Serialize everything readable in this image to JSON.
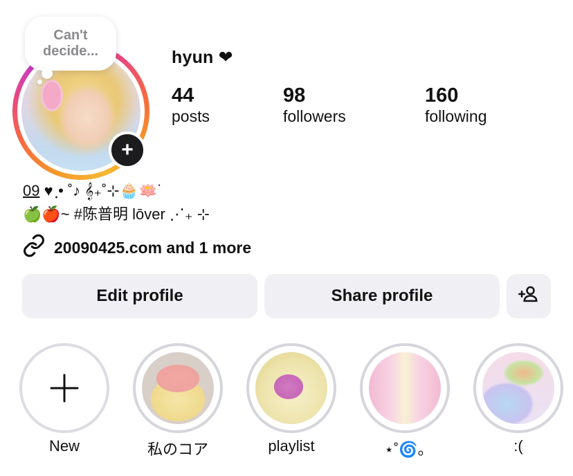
{
  "profile": {
    "note_line1": "Can't",
    "note_line2": "decide...",
    "username": "hyun ❤",
    "add_story_icon": "plus-icon"
  },
  "stats": {
    "posts": {
      "value": "44",
      "label": "posts"
    },
    "followers": {
      "value": "98",
      "label": "followers"
    },
    "following": {
      "value": "160",
      "label": "following"
    }
  },
  "bio": {
    "line1_underlined": "09",
    "line1_rest": " ♥ ฺ• ˚♪ 𝄞₊˚⊹🧁🪷˙",
    "line2": "🍏🍎~ #陈普明 lōver ⋰₊ ⊹"
  },
  "link": {
    "icon": "link-icon",
    "text": "20090425.com and 1 more"
  },
  "buttons": {
    "edit": "Edit profile",
    "share": "Share profile",
    "discover_icon": "add-person-icon"
  },
  "highlights": [
    {
      "label": "New"
    },
    {
      "label": "私のコア"
    },
    {
      "label": "playlist"
    },
    {
      "label": "⋆˚🌀｡"
    },
    {
      "label": ":("
    }
  ],
  "colors": {
    "ring_start": "#d92fa8",
    "ring_end": "#f7b733",
    "button_bg": "#efeff4",
    "highlight_border": "#d5d5dc"
  }
}
